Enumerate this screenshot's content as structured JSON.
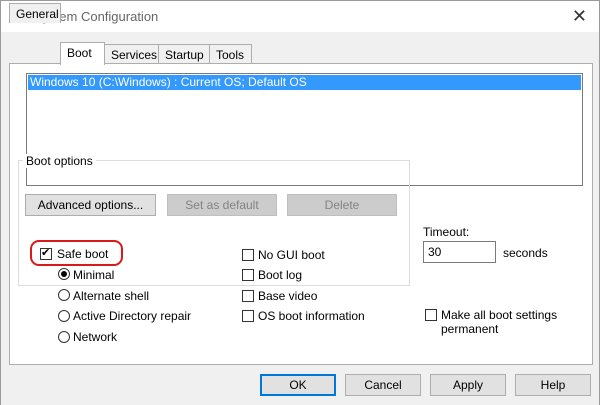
{
  "window": {
    "title": "System Configuration"
  },
  "tabs": [
    {
      "label": "General"
    },
    {
      "label": "Boot"
    },
    {
      "label": "Services"
    },
    {
      "label": "Startup"
    },
    {
      "label": "Tools"
    }
  ],
  "os_list": {
    "items": [
      "Windows 10 (C:\\Windows) : Current OS; Default OS"
    ]
  },
  "buttons_top": {
    "advanced": "Advanced options...",
    "set_default": "Set as default",
    "delete": "Delete"
  },
  "boot_options": {
    "label": "Boot options",
    "safe_boot": {
      "label": "Safe boot",
      "checked": true
    },
    "radios": [
      {
        "label": "Minimal",
        "checked": true
      },
      {
        "label": "Alternate shell",
        "checked": false
      },
      {
        "label": "Active Directory repair",
        "checked": false
      },
      {
        "label": "Network",
        "checked": false
      }
    ],
    "right_checks": [
      {
        "label": "No GUI boot",
        "checked": false
      },
      {
        "label": "Boot log",
        "checked": false
      },
      {
        "label": "Base video",
        "checked": false
      },
      {
        "label": "OS boot information",
        "checked": false
      }
    ]
  },
  "timeout": {
    "label": "Timeout:",
    "value": "30",
    "unit": "seconds"
  },
  "permanent": {
    "label_line1": "Make all boot settings",
    "label_line2": "permanent",
    "checked": false
  },
  "bottom_buttons": {
    "ok": "OK",
    "cancel": "Cancel",
    "apply": "Apply",
    "help": "Help"
  },
  "colors": {
    "selection": "#3399ff",
    "annotation": "#d81a1a",
    "accent": "#0078d7"
  }
}
